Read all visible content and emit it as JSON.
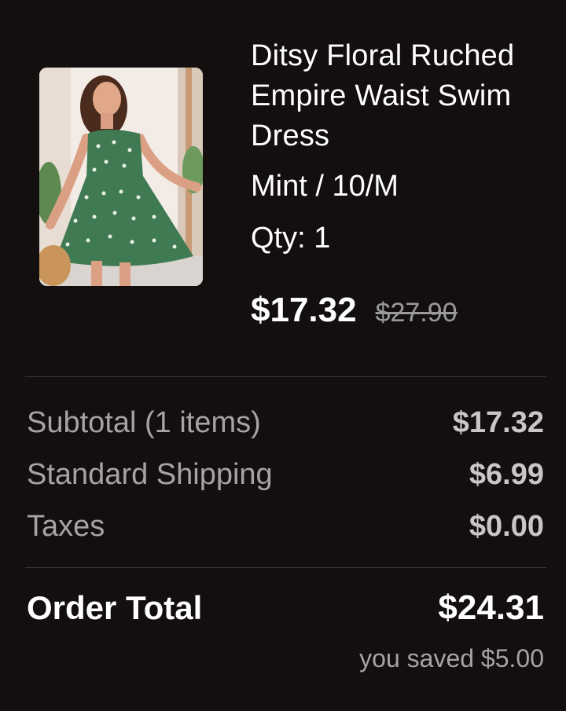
{
  "product": {
    "title": "Ditsy Floral Ruched Empire Waist Swim Dress",
    "variant": "Mint / 10/M",
    "quantity": "Qty: 1",
    "price_current": "$17.32",
    "price_original": "$27.90",
    "image_description_icon": "product-photo"
  },
  "summary": {
    "rows": [
      {
        "label": "Subtotal (1 items)",
        "value": "$17.32"
      },
      {
        "label": "Standard Shipping",
        "value": "$6.99"
      },
      {
        "label": "Taxes",
        "value": "$0.00"
      }
    ],
    "total_label": "Order Total",
    "total_value": "$24.31",
    "saved_text": "you saved $5.00"
  },
  "colors": {
    "background": "#140f0f",
    "text_primary": "#ffffff",
    "text_secondary": "#a6a3a3",
    "strikethrough": "#9a9a9a",
    "divider": "#3a3535"
  }
}
